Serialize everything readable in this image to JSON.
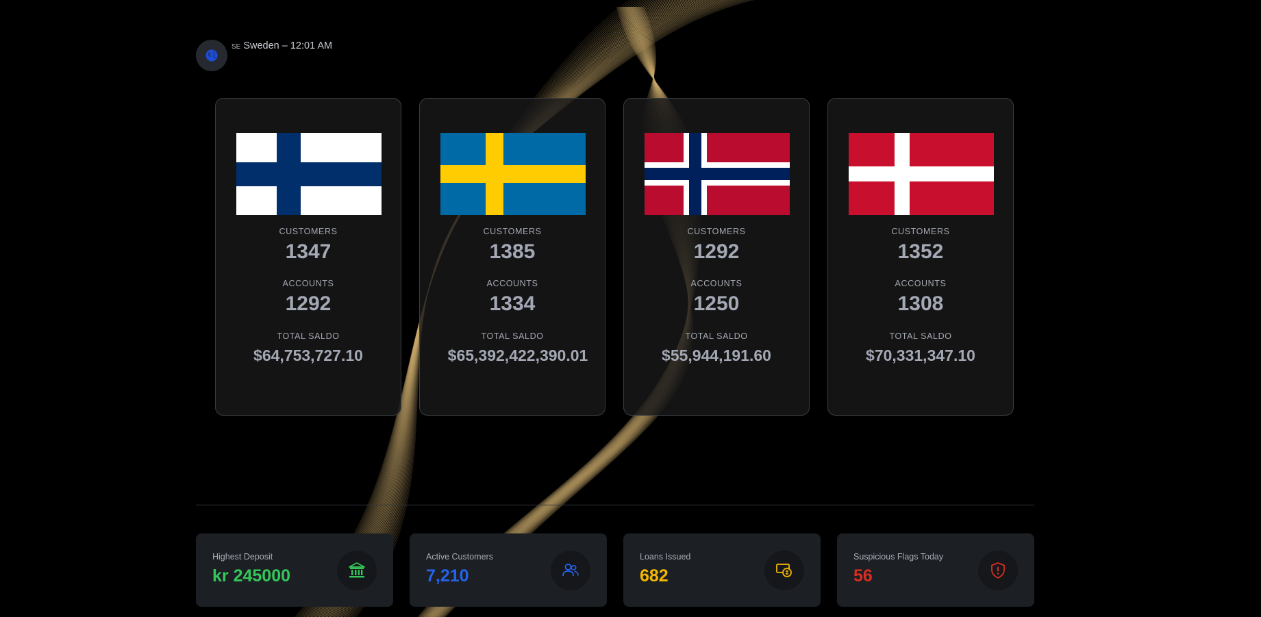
{
  "header": {
    "locale_code": "SE",
    "locale_label": "Sweden – 12:01 AM",
    "globe_icon": "globe-icon"
  },
  "countries": [
    {
      "flag": "finland-flag",
      "customers_label": "CUSTOMERS",
      "customers": "1347",
      "accounts_label": "ACCOUNTS",
      "accounts": "1292",
      "saldo_label": "TOTAL SALDO",
      "saldo": "$64,753,727.10"
    },
    {
      "flag": "sweden-flag",
      "customers_label": "CUSTOMERS",
      "customers": "1385",
      "accounts_label": "ACCOUNTS",
      "accounts": "1334",
      "saldo_label": "TOTAL SALDO",
      "saldo": "$65,392,422,390.01"
    },
    {
      "flag": "norway-flag",
      "customers_label": "CUSTOMERS",
      "customers": "1292",
      "accounts_label": "ACCOUNTS",
      "accounts": "1250",
      "saldo_label": "TOTAL SALDO",
      "saldo": "$55,944,191.60"
    },
    {
      "flag": "denmark-flag",
      "customers_label": "CUSTOMERS",
      "customers": "1352",
      "accounts_label": "ACCOUNTS",
      "accounts": "1308",
      "saldo_label": "TOTAL SALDO",
      "saldo": "$70,331,347.10"
    }
  ],
  "kpis": [
    {
      "label": "Highest Deposit",
      "value": "kr 245000",
      "color": "#34c759",
      "icon": "bank-icon"
    },
    {
      "label": "Active Customers",
      "value": "7,210",
      "color": "#2563eb",
      "icon": "users-icon"
    },
    {
      "label": "Loans Issued",
      "value": "682",
      "color": "#f5b800",
      "icon": "money-bill-icon"
    },
    {
      "label": "Suspicious Flags Today",
      "value": "56",
      "color": "#d92d20",
      "icon": "shield-alert-icon"
    }
  ],
  "colors": {
    "background": "#000000",
    "card_border": "#3a3d42",
    "wave": "#c9a96b"
  }
}
